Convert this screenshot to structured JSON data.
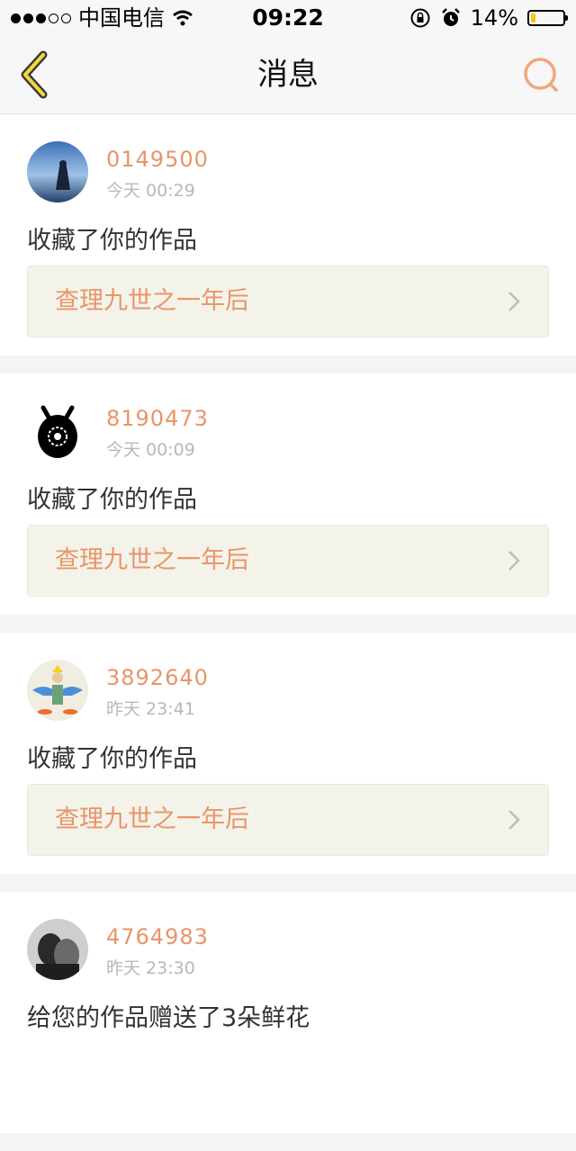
{
  "status_bar": {
    "carrier": "中国电信",
    "time": "09:22",
    "battery": "14%",
    "battery_level": 0.14,
    "signal_bars_on": 3,
    "signal_bars_total": 5
  },
  "nav": {
    "title": "消息",
    "back_icon": "chevron-left-icon",
    "search_icon": "search-icon",
    "accent_color": "#e8956a"
  },
  "messages": [
    {
      "user": "0149500",
      "time": "今天 00:29",
      "action": "收藏了你的作品",
      "work": "查理九世之一年后"
    },
    {
      "user": "8190473",
      "time": "今天 00:09",
      "action": "收藏了你的作品",
      "work": "查理九世之一年后"
    },
    {
      "user": "3892640",
      "time": "昨天 23:41",
      "action": "收藏了你的作品",
      "work": "查理九世之一年后"
    },
    {
      "user": "4764983",
      "time": "昨天 23:30",
      "action": "给您的作品赠送了3朵鲜花"
    }
  ]
}
